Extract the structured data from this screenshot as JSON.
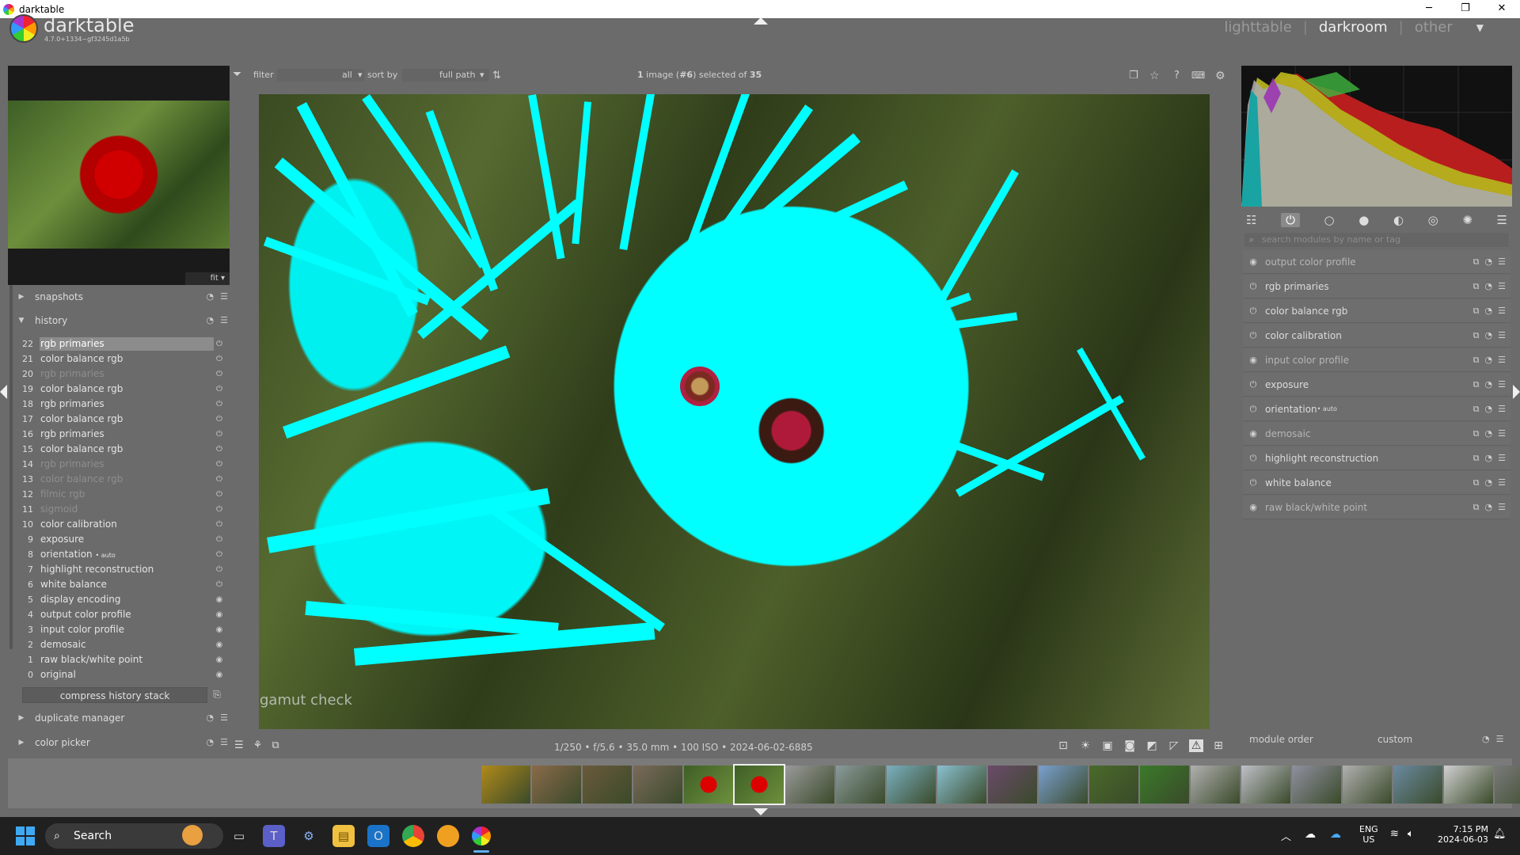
{
  "window": {
    "title": "darktable",
    "min": "─",
    "max": "❐",
    "close": "✕"
  },
  "app": {
    "name": "darktable",
    "version": "4.7.0+1334~gf3245d1a5b"
  },
  "views": {
    "lighttable": "lighttable",
    "sep1": "|",
    "darkroom": "darkroom",
    "sep2": "|",
    "other": "other",
    "dropdown": "▼"
  },
  "toolbar": {
    "filter_label": "filter",
    "filter_value": "all",
    "sortby_label": "sort by",
    "sort_value": "full path",
    "selection_count": "1",
    "selection_text": " image (",
    "selection_id": "#6",
    "selection_text2": ") selected of ",
    "selection_total": "35"
  },
  "navigator": {
    "zoom": "fit"
  },
  "left_modules": {
    "snapshots": "snapshots",
    "history": "history",
    "duplicate_manager": "duplicate manager",
    "color_picker": "color picker",
    "compress": "compress history stack"
  },
  "history": [
    {
      "n": "22",
      "label": "rgb primaries",
      "state": "on",
      "sel": true
    },
    {
      "n": "21",
      "label": "color balance rgb",
      "state": "on"
    },
    {
      "n": "20",
      "label": "rgb primaries",
      "state": "dim"
    },
    {
      "n": "19",
      "label": "color balance rgb",
      "state": "on"
    },
    {
      "n": "18",
      "label": "rgb primaries",
      "state": "on"
    },
    {
      "n": "17",
      "label": "color balance rgb",
      "state": "on"
    },
    {
      "n": "16",
      "label": "rgb primaries",
      "state": "on"
    },
    {
      "n": "15",
      "label": "color balance rgb",
      "state": "on"
    },
    {
      "n": "14",
      "label": "rgb primaries",
      "state": "dim"
    },
    {
      "n": "13",
      "label": "color balance rgb",
      "state": "dim"
    },
    {
      "n": "12",
      "label": "filmic rgb",
      "state": "dim"
    },
    {
      "n": "11",
      "label": "sigmoid",
      "state": "dim"
    },
    {
      "n": "10",
      "label": "color calibration",
      "state": "on"
    },
    {
      "n": "9",
      "label": "exposure",
      "state": "on"
    },
    {
      "n": "8",
      "label": "orientation",
      "state": "on",
      "auto": "• auto"
    },
    {
      "n": "7",
      "label": "highlight reconstruction",
      "state": "on"
    },
    {
      "n": "6",
      "label": "white balance",
      "state": "on"
    },
    {
      "n": "5",
      "label": "display encoding",
      "state": "always"
    },
    {
      "n": "4",
      "label": "output color profile",
      "state": "always"
    },
    {
      "n": "3",
      "label": "input color profile",
      "state": "always"
    },
    {
      "n": "2",
      "label": "demosaic",
      "state": "always"
    },
    {
      "n": "1",
      "label": "raw black/white point",
      "state": "always"
    },
    {
      "n": "0",
      "label": "original",
      "state": "always"
    }
  ],
  "center": {
    "overlay_label": "gamut check",
    "info": "1/250 • f/5.6 • 35.0 mm • 100 ISO • 2024-06-02-6885"
  },
  "right": {
    "search_placeholder": "search modules by name or tag",
    "modules": [
      {
        "label": "output color profile",
        "state": "always"
      },
      {
        "label": "rgb primaries",
        "state": "on"
      },
      {
        "label": "color balance rgb",
        "state": "on"
      },
      {
        "label": "color calibration",
        "state": "on"
      },
      {
        "label": "input color profile",
        "state": "always"
      },
      {
        "label": "exposure",
        "state": "on"
      },
      {
        "label": "orientation",
        "state": "on",
        "auto": "• auto"
      },
      {
        "label": "demosaic",
        "state": "always"
      },
      {
        "label": "highlight reconstruction",
        "state": "on"
      },
      {
        "label": "white balance",
        "state": "on"
      },
      {
        "label": "raw black/white point",
        "state": "always"
      }
    ],
    "module_order_label": "module order",
    "module_order_value": "custom"
  },
  "filmstrip": {
    "thumb_colors": [
      "#b08a1a",
      "#8a6a4a",
      "#6a5a3a",
      "#7a6a5a",
      "#4a6a2a",
      "#5a7a2a",
      "#9a9a9a",
      "#8a9a9a",
      "#7ab0c0",
      "#8ac0d0",
      "#6a4a6a",
      "#7aa0d0",
      "#4a6a2a",
      "#3a7a2a",
      "#b0b0b0",
      "#c0c0c8",
      "#9090a0",
      "#b0b0b0",
      "#6a8aa0",
      "#d0d0d0",
      "#7a7a7a"
    ]
  },
  "taskbar": {
    "search": "Search",
    "lang1": "ENG",
    "lang2": "US",
    "time": "7:15 PM",
    "date": "2024-06-03"
  },
  "colors": {
    "gamut": "#00ffff",
    "panel": "#6b6b6b",
    "taskbar": "#202020"
  }
}
